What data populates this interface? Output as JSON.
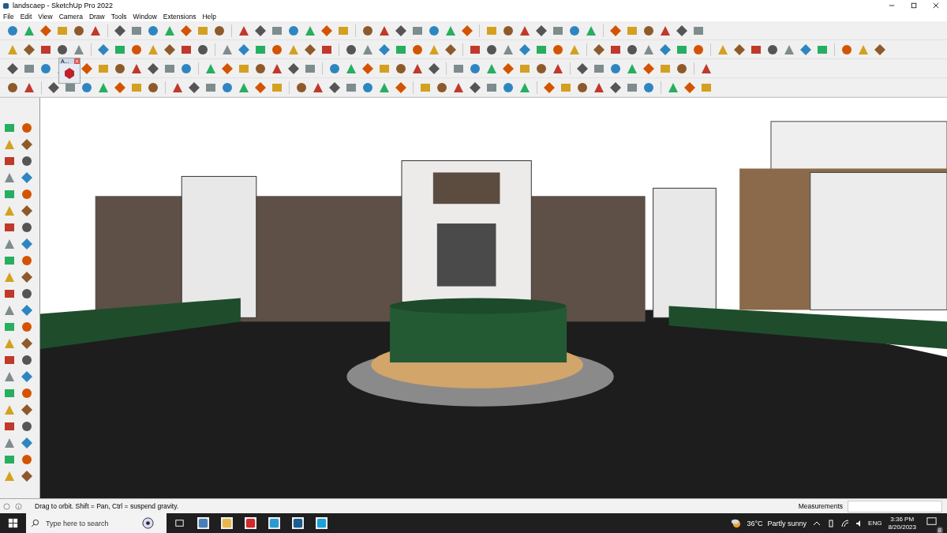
{
  "window": {
    "title": "landscaep - SketchUp Pro 2022"
  },
  "menu": [
    "File",
    "Edit",
    "View",
    "Camera",
    "Draw",
    "Tools",
    "Window",
    "Extensions",
    "Help"
  ],
  "floating_toolbar": {
    "title": "A..."
  },
  "status_bar": {
    "hint": "Drag to orbit. Shift = Pan, Ctrl = suspend gravity.",
    "measurements_label": "Measurements"
  },
  "taskbar": {
    "search_placeholder": "Type here to search",
    "temperature": "36°C",
    "weather": "Partly sunny",
    "language": "ENG",
    "time": "3:36 PM",
    "date": "8/20/2023",
    "notification_count": "8"
  }
}
